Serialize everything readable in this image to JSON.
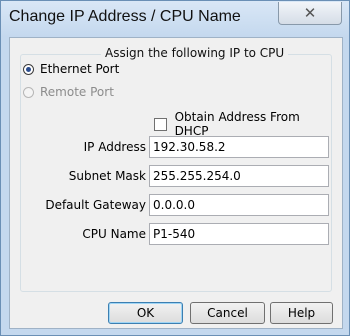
{
  "window": {
    "title": "Change IP Address / CPU Name",
    "close_glyph": "✕"
  },
  "group": {
    "title": "Assign the following IP to CPU"
  },
  "port_options": [
    {
      "label": "Ethernet Port",
      "selected": true,
      "enabled": true
    },
    {
      "label": "Remote Port",
      "selected": false,
      "enabled": false
    }
  ],
  "dhcp": {
    "label": "Obtain Address From DHCP",
    "checked": false
  },
  "fields": [
    {
      "label": "IP Address",
      "value": "192.30.58.2"
    },
    {
      "label": "Subnet Mask",
      "value": "255.255.254.0"
    },
    {
      "label": "Default Gateway",
      "value": "0.0.0.0"
    },
    {
      "label": "CPU Name",
      "value": "P1-540"
    }
  ],
  "buttons": {
    "ok": "OK",
    "cancel": "Cancel",
    "help": "Help"
  },
  "icons": {
    "close": "close-icon"
  }
}
